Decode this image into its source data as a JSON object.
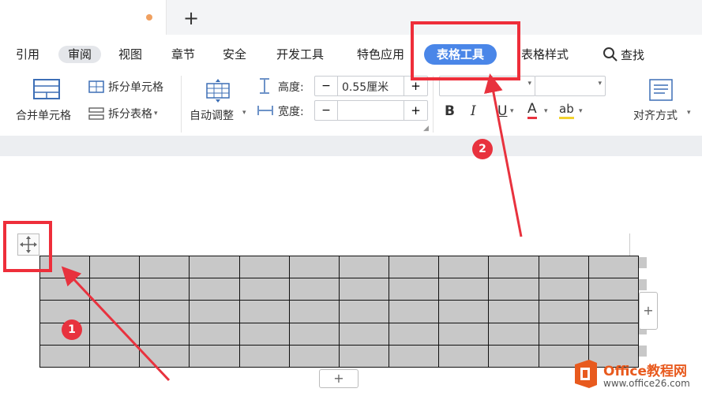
{
  "tabs": {
    "new_tab": "+"
  },
  "ribbon": {
    "tabs": [
      "引用",
      "审阅",
      "视图",
      "章节",
      "安全",
      "开发工具",
      "特色应用",
      "表格工具",
      "表格样式"
    ],
    "search_label": "查找"
  },
  "toolbar": {
    "merge_cells": "合并单元格",
    "split_cells": "拆分单元格",
    "split_table": "拆分表格",
    "auto_fit": "自动调整",
    "height_label": "高度:",
    "height_value": "0.55厘米",
    "width_label": "宽度:",
    "width_value": "",
    "minus": "−",
    "plus": "+",
    "bold": "B",
    "italic": "I",
    "underline": "U",
    "font_color": "A",
    "highlight": "ab",
    "align": "对齐方式"
  },
  "document": {
    "table_rows": 5,
    "table_cols": 12,
    "add_button": "+"
  },
  "annotations": {
    "badge1": "1",
    "badge2": "2"
  },
  "watermark": {
    "title": "Office教程网",
    "url": "www.office26.com"
  },
  "colors": {
    "accent": "#4a86e8",
    "annotation_red": "#ee2e3a",
    "table_fill": "#c8c8c8"
  }
}
